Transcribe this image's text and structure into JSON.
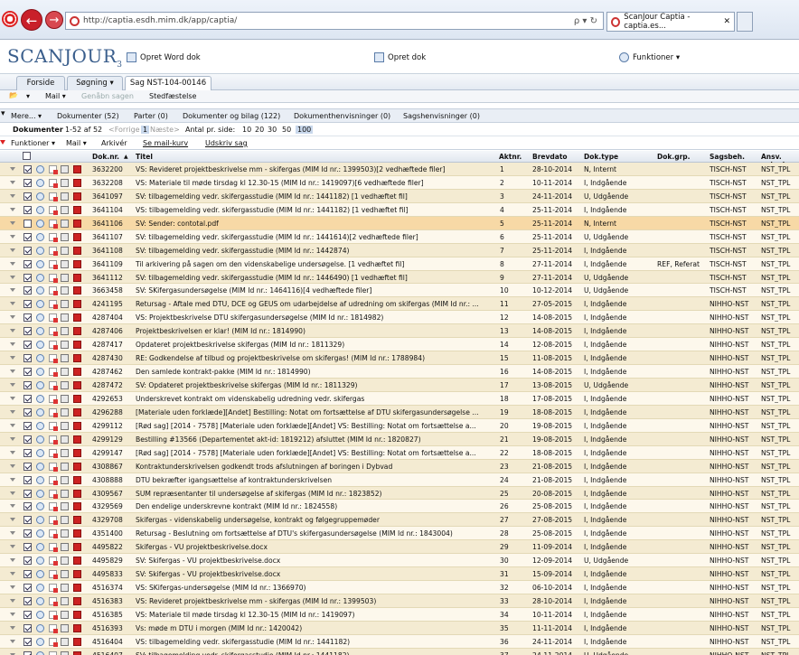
{
  "browser": {
    "url": "http://captia.esdh.mim.dk/app/captia/",
    "tab_title": "ScanJour Captia - captia.es...",
    "addr_icons": "ρ ▾ ↻"
  },
  "app": {
    "brand": "SCANJOUR",
    "brand_sub": "3",
    "toolbar": {
      "word": "Opret Word dok",
      "dok": "Opret dok",
      "funktioner": "Funktioner ▾"
    },
    "tabs": [
      {
        "label": "Forside"
      },
      {
        "label": "Søgning ▾"
      },
      {
        "label": "Sag NST-104-00146"
      }
    ],
    "subbar": {
      "mail": "Mail ▾",
      "genaabn": "Genåbn sagen",
      "stedfaestelse": "Stedfæstelse"
    },
    "filterbar": {
      "mere": "Mere... ▾",
      "dokumenter": "Dokumenter (52)",
      "parter": "Parter (0)",
      "dok_bilag": "Dokumenter og bilag (122)",
      "dokvisninger": "Dokumenthenvisninger (0)",
      "sagsvisninger": "Sagshenvisninger (0)"
    },
    "pager": {
      "label": "Dokumenter",
      "range": "1-52 af 52",
      "forrige": "<Forrige",
      "page": "1",
      "naeste": "Næste>",
      "antal": "Antal pr. side:",
      "sizes": [
        "10",
        "20",
        "30",
        "50",
        "100"
      ]
    },
    "actions": {
      "funktioner": "Funktioner ▾",
      "mail": "Mail ▾",
      "arkiver": "Arkivér",
      "mailkurv": "Se mail-kurv",
      "udskriv": "Udskriv sag"
    },
    "columns": {
      "nr": "Dok.nr.",
      "titel": "Titel",
      "akt": "Aktnr.",
      "dato": "Brevdato",
      "type": "Dok.type",
      "grp": "Dok.grp.",
      "beh": "Sagsbeh.",
      "ansv": "Ansv. enhed"
    },
    "rows": [
      {
        "nr": "3632200",
        "titel": "VS: Revideret projektbeskrivelse mm - skifergas (MIM Id nr.: 1399503)[2 vedhæftede filer]",
        "akt": "1",
        "dato": "28-10-2014",
        "type": "N, Internt",
        "grp": "",
        "beh": "TISCH-NST",
        "ansv": "NST_TPL",
        "checked": true
      },
      {
        "nr": "3632208",
        "titel": "VS: Materiale til møde tirsdag kl 12.30-15 (MIM Id nr.: 1419097)[6 vedhæftede filer]",
        "akt": "2",
        "dato": "10-11-2014",
        "type": "I, Indgående",
        "grp": "",
        "beh": "TISCH-NST",
        "ansv": "NST_TPL",
        "checked": true
      },
      {
        "nr": "3641097",
        "titel": "SV: tilbagemelding vedr. skifergasstudie (MIM Id nr.: 1441182) [1 vedhæftet fil]",
        "akt": "3",
        "dato": "24-11-2014",
        "type": "U, Udgående",
        "grp": "",
        "beh": "TISCH-NST",
        "ansv": "NST_TPL",
        "checked": true
      },
      {
        "nr": "3641104",
        "titel": "VS: tilbagemelding vedr. skifergasstudie (MIM Id nr.: 1441182) [1 vedhæftet fil]",
        "akt": "4",
        "dato": "25-11-2014",
        "type": "I, Indgående",
        "grp": "",
        "beh": "TISCH-NST",
        "ansv": "NST_TPL",
        "checked": true
      },
      {
        "nr": "3641106",
        "titel": "SV: Sender: contotal.pdf",
        "akt": "5",
        "dato": "25-11-2014",
        "type": "N, Internt",
        "grp": "",
        "beh": "TISCH-NST",
        "ansv": "NST_TPL",
        "checked": false,
        "selected": true
      },
      {
        "nr": "3641107",
        "titel": "SV: tilbagemelding vedr. skifergasstudie (MIM Id nr.: 1441614)[2 vedhæftede filer]",
        "akt": "6",
        "dato": "25-11-2014",
        "type": "U, Udgående",
        "grp": "",
        "beh": "TISCH-NST",
        "ansv": "NST_TPL",
        "checked": true
      },
      {
        "nr": "3641108",
        "titel": "SV: tilbagemelding vedr. skifergasstudie (MIM Id nr.: 1442874)",
        "akt": "7",
        "dato": "25-11-2014",
        "type": "I, Indgående",
        "grp": "",
        "beh": "TISCH-NST",
        "ansv": "NST_TPL",
        "checked": true
      },
      {
        "nr": "3641109",
        "titel": "Til arkivering på sagen om den videnskabelige undersøgelse. [1 vedhæftet fil]",
        "akt": "8",
        "dato": "27-11-2014",
        "type": "I, Indgående",
        "grp": "REF, Referat",
        "beh": "TISCH-NST",
        "ansv": "NST_TPL",
        "checked": true
      },
      {
        "nr": "3641112",
        "titel": "SV: tilbagemelding vedr. skifergasstudie (MIM Id nr.: 1446490) [1 vedhæftet fil]",
        "akt": "9",
        "dato": "27-11-2014",
        "type": "U, Udgående",
        "grp": "",
        "beh": "TISCH-NST",
        "ansv": "NST_TPL",
        "checked": true
      },
      {
        "nr": "3663458",
        "titel": "SV: SKifergasundersøgelse (MIM Id nr.: 1464116)[4 vedhæftede filer]",
        "akt": "10",
        "dato": "10-12-2014",
        "type": "U, Udgående",
        "grp": "",
        "beh": "TISCH-NST",
        "ansv": "NST_TPL",
        "checked": true
      },
      {
        "nr": "4241195",
        "titel": "Retursag - Aftale med DTU, DCE og GEUS om udarbejdelse af udredning om skifergas (MIM Id nr.: ...",
        "akt": "11",
        "dato": "27-05-2015",
        "type": "I, Indgående",
        "grp": "",
        "beh": "NIHHO-NST",
        "ansv": "NST_TPL",
        "checked": true
      },
      {
        "nr": "4287404",
        "titel": "VS: Projektbeskrivelse DTU skifergasundersøgelse (MIM Id nr.: 1814982)",
        "akt": "12",
        "dato": "14-08-2015",
        "type": "I, Indgående",
        "grp": "",
        "beh": "NIHHO-NST",
        "ansv": "NST_TPL",
        "checked": true
      },
      {
        "nr": "4287406",
        "titel": "Projektbeskrivelsen er klar! (MIM Id nr.: 1814990)",
        "akt": "13",
        "dato": "14-08-2015",
        "type": "I, Indgående",
        "grp": "",
        "beh": "NIHHO-NST",
        "ansv": "NST_TPL",
        "checked": true
      },
      {
        "nr": "4287417",
        "titel": "Opdateret projektbeskrivelse skifergas (MIM Id nr.: 1811329)",
        "akt": "14",
        "dato": "12-08-2015",
        "type": "I, Indgående",
        "grp": "",
        "beh": "NIHHO-NST",
        "ansv": "NST_TPL",
        "checked": true
      },
      {
        "nr": "4287430",
        "titel": "RE: Godkendelse af tilbud og projektbeskrivelse om skifergas! (MIM Id nr.: 1788984)",
        "akt": "15",
        "dato": "11-08-2015",
        "type": "I, Indgående",
        "grp": "",
        "beh": "NIHHO-NST",
        "ansv": "NST_TPL",
        "checked": true
      },
      {
        "nr": "4287462",
        "titel": "Den samlede kontrakt-pakke (MIM Id nr.: 1814990)",
        "akt": "16",
        "dato": "14-08-2015",
        "type": "I, Indgående",
        "grp": "",
        "beh": "NIHHO-NST",
        "ansv": "NST_TPL",
        "checked": true
      },
      {
        "nr": "4287472",
        "titel": "SV: Opdateret projektbeskrivelse skifergas (MIM Id nr.: 1811329)",
        "akt": "17",
        "dato": "13-08-2015",
        "type": "U, Udgående",
        "grp": "",
        "beh": "NIHHO-NST",
        "ansv": "NST_TPL",
        "checked": true
      },
      {
        "nr": "4292653",
        "titel": "Underskrevet kontrakt om videnskabelig udredning vedr. skifergas",
        "akt": "18",
        "dato": "17-08-2015",
        "type": "I, Indgående",
        "grp": "",
        "beh": "NIHHO-NST",
        "ansv": "NST_TPL",
        "checked": true
      },
      {
        "nr": "4296288",
        "titel": "[Materiale uden forklæde][Andet] Bestilling: Notat om fortsættelse af DTU skifergasundersøgelse ...",
        "akt": "19",
        "dato": "18-08-2015",
        "type": "I, Indgående",
        "grp": "",
        "beh": "NIHHO-NST",
        "ansv": "NST_TPL",
        "checked": true
      },
      {
        "nr": "4299112",
        "titel": "[Rød sag] [2014 - 7578] [Materiale uden forklæde][Andet] VS: Bestilling: Notat om fortsættelse a...",
        "akt": "20",
        "dato": "19-08-2015",
        "type": "I, Indgående",
        "grp": "",
        "beh": "NIHHO-NST",
        "ansv": "NST_TPL",
        "checked": true
      },
      {
        "nr": "4299129",
        "titel": "Bestilling #13566 (Departementet akt-id: 1819212) afsluttet (MIM Id nr.: 1820827)",
        "akt": "21",
        "dato": "19-08-2015",
        "type": "I, Indgående",
        "grp": "",
        "beh": "NIHHO-NST",
        "ansv": "NST_TPL",
        "checked": true
      },
      {
        "nr": "4299147",
        "titel": "[Rød sag] [2014 - 7578] [Materiale uden forklæde][Andet] VS: Bestilling: Notat om fortsættelse a...",
        "akt": "22",
        "dato": "18-08-2015",
        "type": "I, Indgående",
        "grp": "",
        "beh": "NIHHO-NST",
        "ansv": "NST_TPL",
        "checked": true
      },
      {
        "nr": "4308867",
        "titel": "Kontraktunderskrivelsen godkendt trods afslutningen af boringen i Dybvad",
        "akt": "23",
        "dato": "21-08-2015",
        "type": "I, Indgående",
        "grp": "",
        "beh": "NIHHO-NST",
        "ansv": "NST_TPL",
        "checked": true
      },
      {
        "nr": "4308888",
        "titel": "DTU bekræfter igangsættelse af kontraktunderskrivelsen",
        "akt": "24",
        "dato": "21-08-2015",
        "type": "I, Indgående",
        "grp": "",
        "beh": "NIHHO-NST",
        "ansv": "NST_TPL",
        "checked": true
      },
      {
        "nr": "4309567",
        "titel": "SUM repræsentanter til undersøgelse af skifergas (MIM Id nr.: 1823852)",
        "akt": "25",
        "dato": "20-08-2015",
        "type": "I, Indgående",
        "grp": "",
        "beh": "NIHHO-NST",
        "ansv": "NST_TPL",
        "checked": true
      },
      {
        "nr": "4329569",
        "titel": "Den endelige underskrevne kontrakt (MIM Id nr.: 1824558)",
        "akt": "26",
        "dato": "25-08-2015",
        "type": "I, Indgående",
        "grp": "",
        "beh": "NIHHO-NST",
        "ansv": "NST_TPL",
        "checked": true
      },
      {
        "nr": "4329708",
        "titel": "Skifergas - videnskabelig undersøgelse, kontrakt og følgegruppemøder",
        "akt": "27",
        "dato": "27-08-2015",
        "type": "I, Indgående",
        "grp": "",
        "beh": "NIHHO-NST",
        "ansv": "NST_TPL",
        "checked": true
      },
      {
        "nr": "4351400",
        "titel": "Retursag - Beslutning om fortsættelse af DTU's skifergasundersøgelse (MIM Id nr.: 1843004)",
        "akt": "28",
        "dato": "25-08-2015",
        "type": "I, Indgående",
        "grp": "",
        "beh": "NIHHO-NST",
        "ansv": "NST_TPL",
        "checked": true
      },
      {
        "nr": "4495822",
        "titel": "Skifergas - VU projektbeskrivelse.docx",
        "akt": "29",
        "dato": "11-09-2014",
        "type": "I, Indgående",
        "grp": "",
        "beh": "NIHHO-NST",
        "ansv": "NST_TPL",
        "checked": true
      },
      {
        "nr": "4495829",
        "titel": "SV: Skifergas - VU projektbeskrivelse.docx",
        "akt": "30",
        "dato": "12-09-2014",
        "type": "U, Udgående",
        "grp": "",
        "beh": "NIHHO-NST",
        "ansv": "NST_TPL",
        "checked": true
      },
      {
        "nr": "4495833",
        "titel": "SV: Skifergas - VU projektbeskrivelse.docx",
        "akt": "31",
        "dato": "15-09-2014",
        "type": "I, Indgående",
        "grp": "",
        "beh": "NIHHO-NST",
        "ansv": "NST_TPL",
        "checked": true
      },
      {
        "nr": "4516374",
        "titel": "VS: SKifergas-undersøgelse (MIM Id nr.: 1366970)",
        "akt": "32",
        "dato": "06-10-2014",
        "type": "I, Indgående",
        "grp": "",
        "beh": "NIHHO-NST",
        "ansv": "NST_TPL",
        "checked": true
      },
      {
        "nr": "4516383",
        "titel": "VS: Revideret projektbeskrivelse mm - skifergas (MIM Id nr.: 1399503)",
        "akt": "33",
        "dato": "28-10-2014",
        "type": "I, Indgående",
        "grp": "",
        "beh": "NIHHO-NST",
        "ansv": "NST_TPL",
        "checked": true
      },
      {
        "nr": "4516385",
        "titel": "VS: Materiale til møde tirsdag kl 12.30-15 (MIM Id nr.: 1419097)",
        "akt": "34",
        "dato": "10-11-2014",
        "type": "I, Indgående",
        "grp": "",
        "beh": "NIHHO-NST",
        "ansv": "NST_TPL",
        "checked": true
      },
      {
        "nr": "4516393",
        "titel": "Vs: møde m DTU i morgen (MIM Id nr.: 1420042)",
        "akt": "35",
        "dato": "11-11-2014",
        "type": "I, Indgående",
        "grp": "",
        "beh": "NIHHO-NST",
        "ansv": "NST_TPL",
        "checked": true
      },
      {
        "nr": "4516404",
        "titel": "VS: tilbagemelding vedr. skifergasstudie (MIM Id nr.: 1441182)",
        "akt": "36",
        "dato": "24-11-2014",
        "type": "I, Indgående",
        "grp": "",
        "beh": "NIHHO-NST",
        "ansv": "NST_TPL",
        "checked": true
      },
      {
        "nr": "4516407",
        "titel": "SV: tilbagemelding vedr. skifergasstudie (MIM Id nr.: 1441182)",
        "akt": "37",
        "dato": "24-11-2014",
        "type": "U, Udgående",
        "grp": "",
        "beh": "NIHHO-NST",
        "ansv": "NST_TPL",
        "checked": true
      }
    ]
  }
}
